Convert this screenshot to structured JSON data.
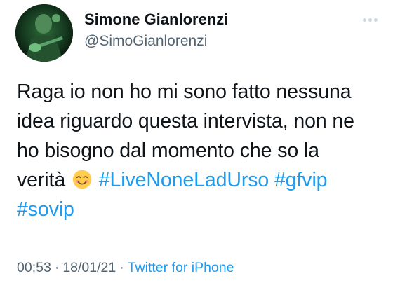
{
  "author": {
    "display_name": "Simone Gianlorenzi",
    "handle": "@SimoGianlorenzi"
  },
  "tweet": {
    "lines": [
      "Raga io non ho mi sono fatto nessuna",
      "idea riguardo questa intervista, non ne",
      "ho bisogno dal momento che so la"
    ],
    "line4_text": "verità",
    "emoji": "smiling-face-emoji",
    "hashtags": [
      "#LiveNoneLadUrso",
      "#gfvip",
      "#sovip"
    ]
  },
  "meta": {
    "time": "00:53",
    "separator": "·",
    "date": "18/01/21",
    "source": "Twitter for iPhone"
  },
  "icons": {
    "more": "more-options-icon"
  },
  "colors": {
    "text": "#0f1419",
    "secondary": "#536471",
    "link": "#1d9bf0"
  }
}
